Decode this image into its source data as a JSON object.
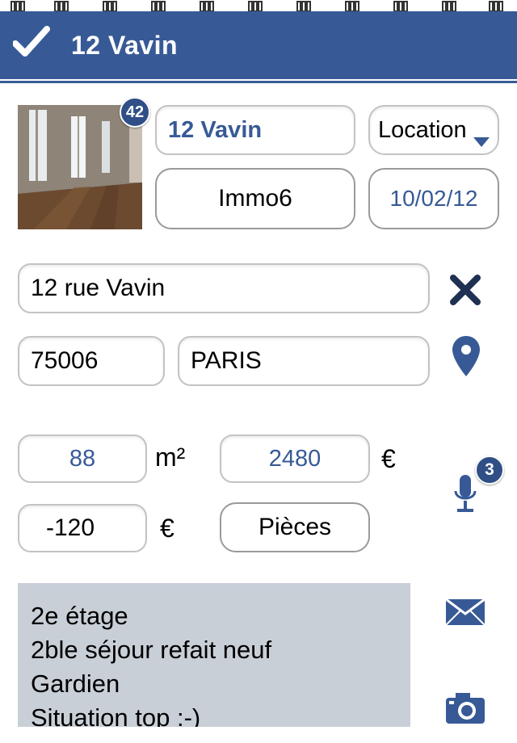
{
  "header": {
    "title": "12 Vavin",
    "check_icon": "check-icon"
  },
  "photo": {
    "count_badge": "42"
  },
  "property": {
    "name": "12 Vavin",
    "type_select": "Location",
    "agency": "Immo6",
    "date": "10/02/12"
  },
  "address": {
    "street": "12 rue Vavin",
    "postcode": "75006",
    "city": "PARIS"
  },
  "details": {
    "surface": "88",
    "surface_unit": "m²",
    "price": "2480",
    "price_unit": "€",
    "adjustment": "-120",
    "adjustment_unit": "€",
    "rooms_button": "Pièces"
  },
  "audio": {
    "count_badge": "3"
  },
  "notes": {
    "lines": [
      "2e étage",
      "2ble séjour refait neuf",
      "Gardien",
      "Situation top :-)"
    ]
  },
  "colors": {
    "brand": "#375a96",
    "notes_bg": "#c9cfd7"
  }
}
